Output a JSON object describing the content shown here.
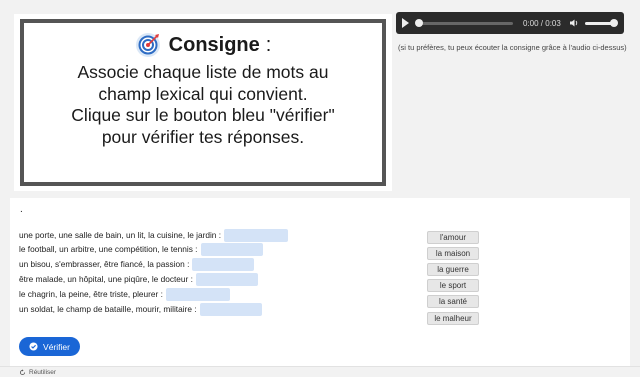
{
  "consigne": {
    "title": "Consigne",
    "colon": ":",
    "lines": [
      "Associe chaque liste de mots au",
      "champ lexical qui convient.",
      "Clique sur le bouton bleu \"vérifier\"",
      "pour vérifier tes réponses."
    ]
  },
  "audio": {
    "time": "0:00 / 0:03",
    "note": "(si tu préfères, tu peux écouter la consigne grâce à l'audio ci-dessus)"
  },
  "exercise": {
    "dot": ".",
    "rows": [
      {
        "text": "une porte, une salle de bain, un lit, la cuisine, le jardin :"
      },
      {
        "text": "le football, un arbitre, une compétition, le tennis :"
      },
      {
        "text": "un bisou, s'embrasser, être fiancé, la passion :"
      },
      {
        "text": "être malade, un hôpital, une piqûre, le docteur :"
      },
      {
        "text": "le chagrin, la peine, être triste, pleurer :"
      },
      {
        "text": "un soldat, le champ de bataille, mourir, militaire :"
      }
    ],
    "words": [
      "l'amour",
      "la maison",
      "la guerre",
      "le sport",
      "la santé",
      "le malheur"
    ],
    "verify_label": "Vérifier",
    "reset_label": "Réutiliser"
  },
  "colors": {
    "accent": "#1a66d6",
    "drop_zone": "#d4e3f7"
  }
}
